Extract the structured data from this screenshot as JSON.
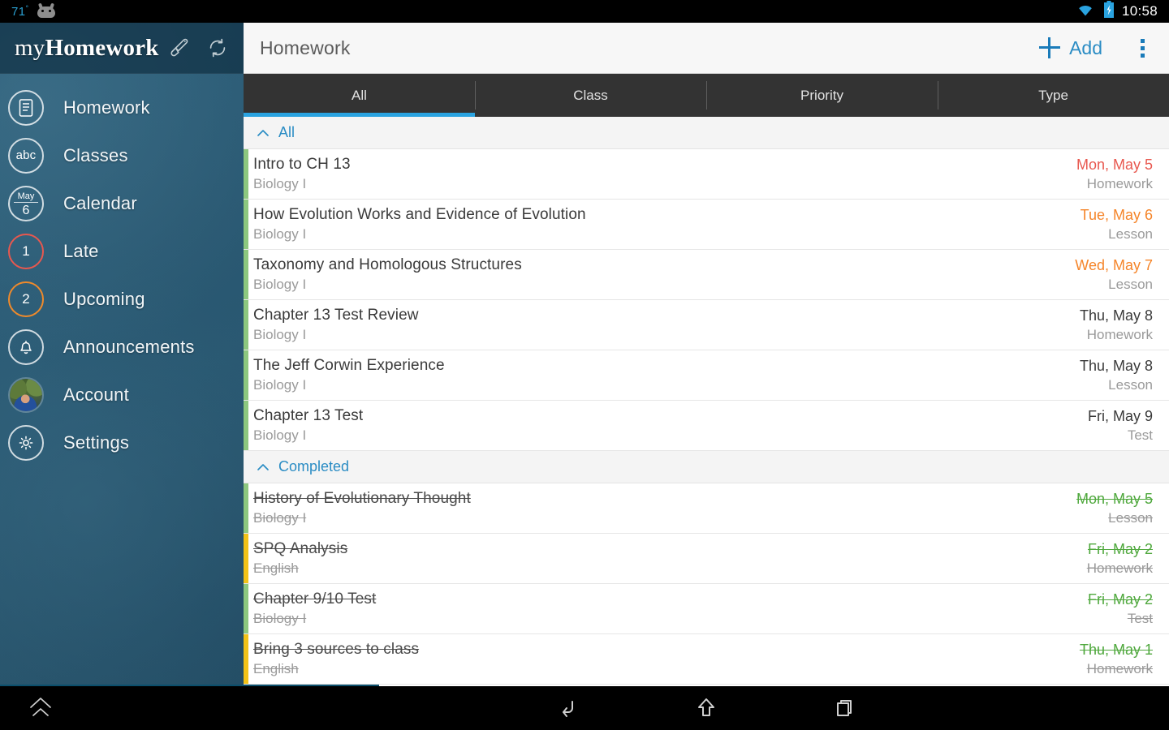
{
  "status_bar": {
    "temperature": "71",
    "degree": "°",
    "android_icon": "android-robot-icon",
    "wifi_icon": "wifi-icon",
    "battery_icon": "battery-charging-icon",
    "time": "10:58"
  },
  "sidebar": {
    "brand_prefix": "my",
    "brand_suffix": "Homework",
    "brush_icon": "paintbrush-icon",
    "sync_icon": "sync-refresh-icon",
    "items": [
      {
        "label": "Homework",
        "icon": "document-list-icon",
        "icon_kind": "doc",
        "accent": "#ffffff"
      },
      {
        "label": "Classes",
        "icon": "abc-icon",
        "icon_kind": "abc",
        "accent": "#ffffff",
        "glyph": "abc"
      },
      {
        "label": "Calendar",
        "icon": "calendar-icon",
        "icon_kind": "cal",
        "accent": "#ffffff",
        "month": "May",
        "day": "6"
      },
      {
        "label": "Late",
        "icon": "late-count-icon",
        "icon_kind": "count",
        "accent": "#e8584f",
        "count": "1"
      },
      {
        "label": "Upcoming",
        "icon": "upcoming-count-icon",
        "icon_kind": "count",
        "accent": "#ef8a2b",
        "count": "2"
      },
      {
        "label": "Announcements",
        "icon": "bell-icon",
        "icon_kind": "bell",
        "accent": "#ffffff"
      },
      {
        "label": "Account",
        "icon": "user-avatar-icon",
        "icon_kind": "avatar",
        "accent": "#ffffff"
      },
      {
        "label": "Settings",
        "icon": "gear-icon",
        "icon_kind": "gear",
        "accent": "#ffffff"
      }
    ]
  },
  "action_bar": {
    "title": "Homework",
    "add_label": "Add",
    "plus_icon": "plus-icon",
    "overflow_icon": "overflow-menu-icon",
    "accent_color": "#2a8cc4"
  },
  "tabs": [
    {
      "label": "All",
      "active": true
    },
    {
      "label": "Class",
      "active": false
    },
    {
      "label": "Priority",
      "active": false
    },
    {
      "label": "Type",
      "active": false
    }
  ],
  "groups": [
    {
      "label": "All",
      "chevron_icon": "chevron-up-icon",
      "expanded": true,
      "rows": [
        {
          "title": "Intro to CH 13",
          "klass": "Biology I",
          "date": "Mon, May 5",
          "type": "Homework",
          "date_color": "red",
          "bar": "green",
          "done": false
        },
        {
          "title": "How Evolution Works and Evidence of Evolution",
          "klass": "Biology I",
          "date": "Tue, May 6",
          "type": "Lesson",
          "date_color": "orange",
          "bar": "green",
          "done": false
        },
        {
          "title": "Taxonomy and Homologous Structures",
          "klass": "Biology I",
          "date": "Wed, May 7",
          "type": "Lesson",
          "date_color": "orange",
          "bar": "green",
          "done": false
        },
        {
          "title": "Chapter 13 Test Review",
          "klass": "Biology I",
          "date": "Thu, May 8",
          "type": "Homework",
          "date_color": "dark",
          "bar": "green",
          "done": false
        },
        {
          "title": "The Jeff Corwin Experience",
          "klass": "Biology I",
          "date": "Thu, May 8",
          "type": "Lesson",
          "date_color": "dark",
          "bar": "green",
          "done": false
        },
        {
          "title": "Chapter 13 Test",
          "klass": "Biology I",
          "date": "Fri, May 9",
          "type": "Test",
          "date_color": "dark",
          "bar": "green",
          "done": false
        }
      ]
    },
    {
      "label": "Completed",
      "chevron_icon": "chevron-up-icon",
      "expanded": true,
      "rows": [
        {
          "title": "History of Evolutionary Thought",
          "klass": "Biology I",
          "date": "Mon, May 5",
          "type": "Lesson",
          "date_color": "green",
          "bar": "green",
          "done": true
        },
        {
          "title": "SPQ Analysis",
          "klass": "English",
          "date": "Fri, May 2",
          "type": "Homework",
          "date_color": "green",
          "bar": "yellow",
          "done": true
        },
        {
          "title": "Chapter 9/10 Test",
          "klass": "Biology I",
          "date": "Fri, May 2",
          "type": "Test",
          "date_color": "green",
          "bar": "green",
          "done": true
        },
        {
          "title": "Bring 3 sources to class",
          "klass": "English",
          "date": "Thu, May 1",
          "type": "Homework",
          "date_color": "green",
          "bar": "yellow",
          "done": true
        }
      ]
    }
  ],
  "nav_bar": {
    "app_icon": "double-chevron-up-icon",
    "back_icon": "back-arrow-icon",
    "home_icon": "home-arrow-icon",
    "recents_icon": "recent-apps-icon"
  }
}
